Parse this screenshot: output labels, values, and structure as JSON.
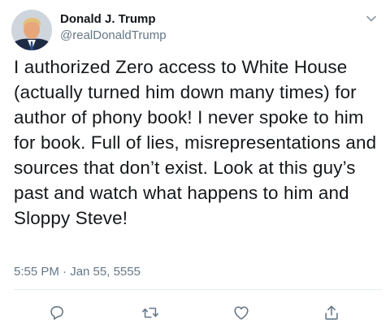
{
  "user": {
    "display_name": "Donald J. Trump",
    "handle": "@realDonaldTrump"
  },
  "tweet": {
    "text": "I authorized Zero access to White House (actually turned him down many times) for author of phony book! I never spoke to him for book. Full of lies, misrepresentations and sources that don’t exist. Look at this guy’s past and watch what happens to him and Sloppy Steve!",
    "timestamp": "5:55 PM · Jan 55, 5555"
  },
  "icons": {
    "menu": "chevron-down-icon",
    "reply": "reply-icon",
    "retweet": "retweet-icon",
    "like": "heart-icon",
    "share": "share-icon"
  },
  "colors": {
    "text_primary": "#14171a",
    "text_secondary": "#657786",
    "icon": "#657786",
    "divider": "#e6ecf0"
  }
}
